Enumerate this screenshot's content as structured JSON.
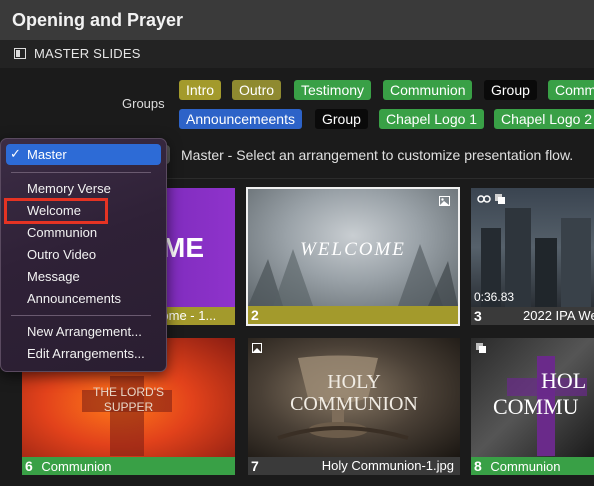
{
  "window": {
    "title": "Opening and Prayer"
  },
  "section": {
    "label": "MASTER SLIDES",
    "icon": "speaker-icon"
  },
  "groups": {
    "label": "Groups",
    "chips_row1": [
      {
        "label": "Intro",
        "color": "#a39a2c"
      },
      {
        "label": "Outro",
        "color": "#8f8a30"
      },
      {
        "label": "Testimony",
        "color": "#39a046"
      },
      {
        "label": "Communion",
        "color": "#39a046"
      },
      {
        "label": "Group",
        "color": "#0a0a0a"
      },
      {
        "label": "Comm",
        "color": "#39a046"
      }
    ],
    "chips_row2": [
      {
        "label": "Announcemeents",
        "color": "#2d63c8"
      },
      {
        "label": "Group",
        "color": "#0a0a0a"
      },
      {
        "label": "Chapel Logo 1",
        "color": "#39a046"
      },
      {
        "label": "Chapel Logo 2",
        "color": "#39a046"
      }
    ]
  },
  "arrangement": {
    "hint": "Master - Select an arrangement to customize presentation flow."
  },
  "menu": {
    "selected": "Master",
    "items": [
      "Memory Verse",
      "Welcome",
      "Communion",
      "Outro Video",
      "Message",
      "Announcements"
    ],
    "actions": [
      "New Arrangement...",
      "Edit Arrangements..."
    ]
  },
  "slides": [
    {
      "number": "",
      "name": "lcome - 1...",
      "caption_color": "#a39a2c",
      "thumb_text": "ME"
    },
    {
      "number": "2",
      "name": "",
      "caption_color": "#a39a2c",
      "thumb_text": "WELCOME"
    },
    {
      "number": "3",
      "name": "2022 IPA We",
      "caption_color": "#3a3a3a",
      "timer": "0:36.83"
    },
    {
      "number": "6",
      "name": "Communion",
      "caption_color": "#39a046",
      "thumb_text1": "THE LORD'S",
      "thumb_text2": "SUPPER"
    },
    {
      "number": "7",
      "name": "Holy Communion-1.jpg",
      "caption_color": "#3a3a3a",
      "thumb_text1": "HOLY",
      "thumb_text2": "COMMUNION"
    },
    {
      "number": "8",
      "name": "Communion",
      "caption_color": "#39a046",
      "thumb_text1": "HOL",
      "thumb_text2": "COMMU"
    }
  ]
}
